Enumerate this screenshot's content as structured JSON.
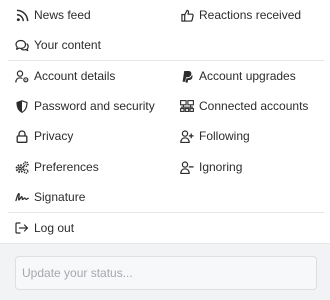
{
  "menu": {
    "left": [
      {
        "name": "menu-item-news-feed",
        "icon": "rss-icon",
        "label": "News feed"
      },
      {
        "name": "menu-item-your-content",
        "icon": "comments-icon",
        "label": "Your content"
      },
      {
        "name": "menu-item-account-details",
        "icon": "user-cog-icon",
        "label": "Account details"
      },
      {
        "name": "menu-item-password-security",
        "icon": "shield-icon",
        "label": "Password and security"
      },
      {
        "name": "menu-item-privacy",
        "icon": "lock-icon",
        "label": "Privacy"
      },
      {
        "name": "menu-item-preferences",
        "icon": "cogs-icon",
        "label": "Preferences"
      },
      {
        "name": "menu-item-signature",
        "icon": "signature-icon",
        "label": "Signature"
      },
      {
        "name": "menu-item-log-out",
        "icon": "sign-out-icon",
        "label": "Log out"
      }
    ],
    "right": [
      {
        "name": "menu-item-reactions-received",
        "icon": "thumbs-up-icon",
        "label": "Reactions received"
      },
      {
        "name": "menu-item-account-upgrades",
        "icon": "paypal-icon",
        "label": "Account upgrades"
      },
      {
        "name": "menu-item-connected-accounts",
        "icon": "connected-accounts-icon",
        "label": "Connected accounts"
      },
      {
        "name": "menu-item-following",
        "icon": "user-plus-icon",
        "label": "Following"
      },
      {
        "name": "menu-item-ignoring",
        "icon": "user-minus-icon",
        "label": "Ignoring"
      }
    ]
  },
  "status": {
    "placeholder": "Update your status...",
    "value": ""
  }
}
